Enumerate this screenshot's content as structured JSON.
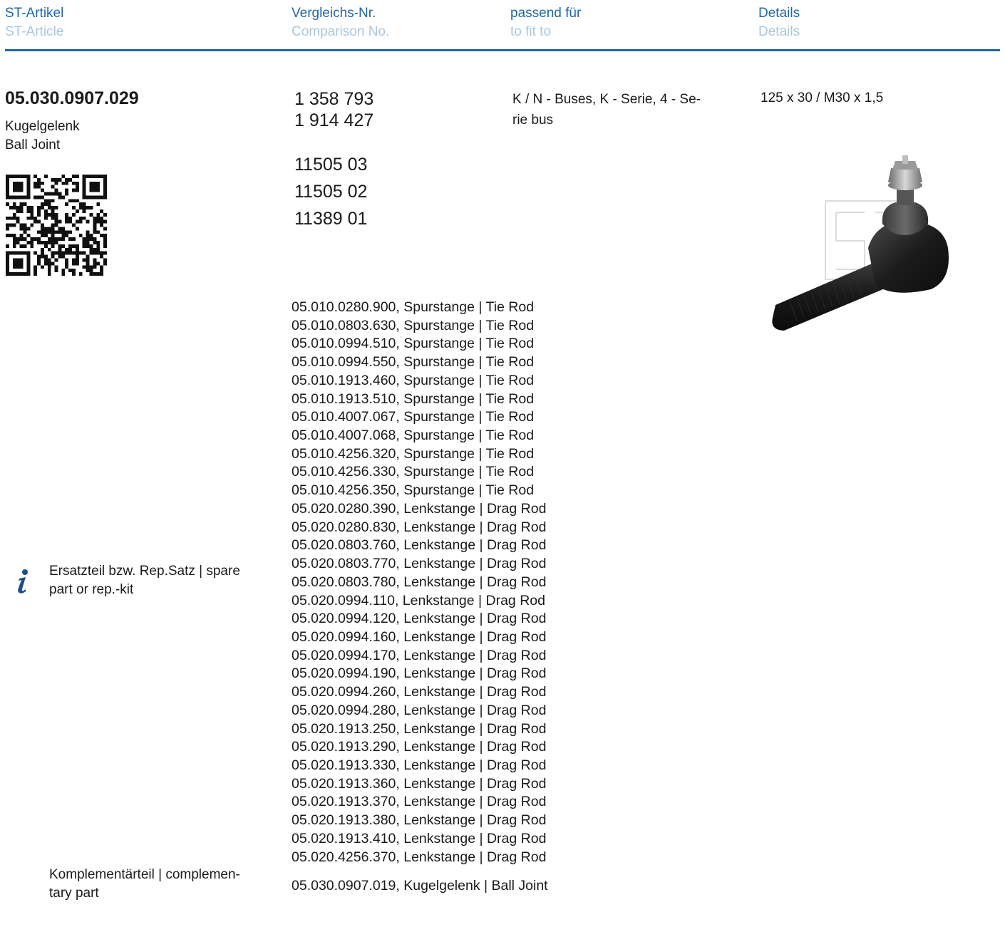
{
  "header": {
    "columns": [
      {
        "de": "ST-Artikel",
        "en": "ST-Article"
      },
      {
        "de": "Vergleichs-Nr.",
        "en": "Comparison No."
      },
      {
        "de": "passend für",
        "en": "to fit to"
      },
      {
        "de": "Details",
        "en": "Details"
      }
    ]
  },
  "colors": {
    "accent": "#1f66a3",
    "header_sub": "#a9c6de"
  },
  "article": {
    "number": "05.030.0907.029",
    "name_de": "Kugelgelenk",
    "name_en": "Ball Joint"
  },
  "comparison_numbers": {
    "group1": [
      "1 358 793",
      "1 914 427"
    ],
    "group2": [
      "11505 03",
      "11505 02",
      "11389 01"
    ]
  },
  "fit_to": {
    "line1": "K / N - Buses, K - Serie, 4 - Se-",
    "line2": "rie bus"
  },
  "details": {
    "text": "125 x 30 / M30 x 1,5"
  },
  "spare_parts": {
    "label_line1": "Ersatzteil bzw. Rep.Satz | spare",
    "label_line2": "part or rep.-kit",
    "icon": "info-icon",
    "items": [
      "05.010.0280.900, Spurstange | Tie Rod",
      "05.010.0803.630, Spurstange | Tie Rod",
      "05.010.0994.510, Spurstange | Tie Rod",
      "05.010.0994.550, Spurstange | Tie Rod",
      "05.010.1913.460, Spurstange | Tie Rod",
      "05.010.1913.510, Spurstange | Tie Rod",
      "05.010.4007.067, Spurstange | Tie Rod",
      "05.010.4007.068, Spurstange | Tie Rod",
      "05.010.4256.320, Spurstange | Tie Rod",
      "05.010.4256.330, Spurstange | Tie Rod",
      "05.010.4256.350, Spurstange | Tie Rod",
      "05.020.0280.390, Lenkstange | Drag Rod",
      "05.020.0280.830, Lenkstange | Drag Rod",
      "05.020.0803.760, Lenkstange | Drag Rod",
      "05.020.0803.770, Lenkstange | Drag Rod",
      "05.020.0803.780, Lenkstange | Drag Rod",
      "05.020.0994.110, Lenkstange | Drag Rod",
      "05.020.0994.120, Lenkstange | Drag Rod",
      "05.020.0994.160, Lenkstange | Drag Rod",
      "05.020.0994.170, Lenkstange | Drag Rod",
      "05.020.0994.190, Lenkstange | Drag Rod",
      "05.020.0994.260, Lenkstange | Drag Rod",
      "05.020.0994.280, Lenkstange | Drag Rod",
      "05.020.1913.250, Lenkstange | Drag Rod",
      "05.020.1913.290, Lenkstange | Drag Rod",
      "05.020.1913.330, Lenkstange | Drag Rod",
      "05.020.1913.360, Lenkstange | Drag Rod",
      "05.020.1913.370, Lenkstange | Drag Rod",
      "05.020.1913.380, Lenkstange | Drag Rod",
      "05.020.1913.410, Lenkstange | Drag Rod",
      "05.020.4256.370, Lenkstange | Drag Rod"
    ]
  },
  "complementary": {
    "label_line1": "Komplementärteil  | complemen-",
    "label_line2": "tary part",
    "value": "05.030.0907.019, Kugelgelenk | Ball Joint"
  }
}
